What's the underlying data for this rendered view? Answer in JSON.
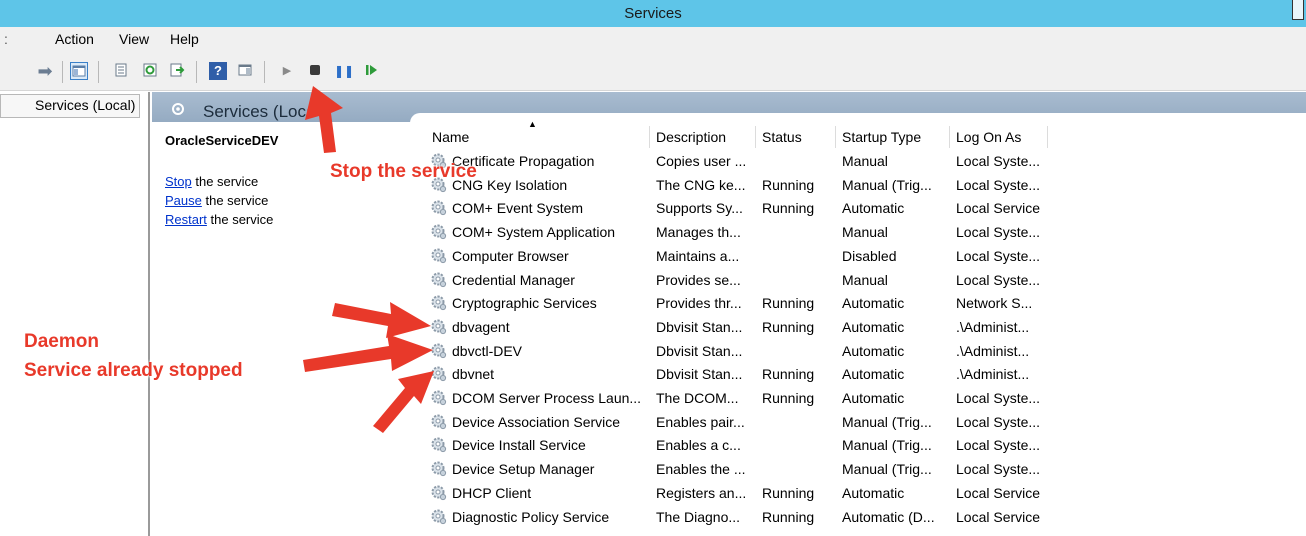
{
  "window": {
    "title": "Services"
  },
  "menu": {
    "items": [
      "Action",
      "View",
      "Help"
    ]
  },
  "toolbar": {
    "icons": [
      "forward-icon",
      "show-tree-icon",
      "properties-icon",
      "refresh-icon",
      "export-list-icon",
      "help-icon",
      "show-panel-icon",
      "start-service-icon",
      "stop-service-icon",
      "pause-service-icon",
      "resume-service-icon"
    ]
  },
  "tree": {
    "item": "Services (Local)"
  },
  "header": {
    "title": "Services (Loca"
  },
  "details": {
    "service_name": "OracleServiceDEV",
    "actions": [
      {
        "link": "Stop",
        "rest": " the service"
      },
      {
        "link": "Pause",
        "rest": " the service"
      },
      {
        "link": "Restart",
        "rest": " the service"
      }
    ]
  },
  "list": {
    "columns": [
      "Name",
      "Description",
      "Status",
      "Startup Type",
      "Log On As"
    ],
    "rows": [
      [
        "Certificate Propagation",
        "Copies user ...",
        "",
        "Manual",
        "Local Syste..."
      ],
      [
        "CNG Key Isolation",
        "The CNG ke...",
        "Running",
        "Manual (Trig...",
        "Local Syste..."
      ],
      [
        "COM+ Event System",
        "Supports Sy...",
        "Running",
        "Automatic",
        "Local Service"
      ],
      [
        "COM+ System Application",
        "Manages th...",
        "",
        "Manual",
        "Local Syste..."
      ],
      [
        "Computer Browser",
        "Maintains a...",
        "",
        "Disabled",
        "Local Syste..."
      ],
      [
        "Credential Manager",
        "Provides se...",
        "",
        "Manual",
        "Local Syste..."
      ],
      [
        "Cryptographic Services",
        "Provides thr...",
        "Running",
        "Automatic",
        "Network S..."
      ],
      [
        "dbvagent",
        "Dbvisit Stan...",
        "Running",
        "Automatic",
        ".\\Administ..."
      ],
      [
        "dbvctl-DEV",
        "Dbvisit Stan...",
        "",
        "Automatic",
        ".\\Administ..."
      ],
      [
        "dbvnet",
        "Dbvisit Stan...",
        "Running",
        "Automatic",
        ".\\Administ..."
      ],
      [
        "DCOM Server Process Laun...",
        "The DCOM...",
        "Running",
        "Automatic",
        "Local Syste..."
      ],
      [
        "Device Association Service",
        "Enables pair...",
        "",
        "Manual (Trig...",
        "Local Syste..."
      ],
      [
        "Device Install Service",
        "Enables a c...",
        "",
        "Manual (Trig...",
        "Local Syste..."
      ],
      [
        "Device Setup Manager",
        "Enables the ...",
        "",
        "Manual (Trig...",
        "Local Syste..."
      ],
      [
        "DHCP Client",
        "Registers an...",
        "Running",
        "Automatic",
        "Local Service"
      ],
      [
        "Diagnostic Policy Service",
        "The Diagno...",
        "Running",
        "Automatic (D...",
        "Local Service"
      ]
    ]
  },
  "annotations": {
    "stop_label": "Stop the service",
    "daemon_label": "Daemon",
    "stopped_label": "Service already stopped",
    "color": "#e8392a"
  }
}
